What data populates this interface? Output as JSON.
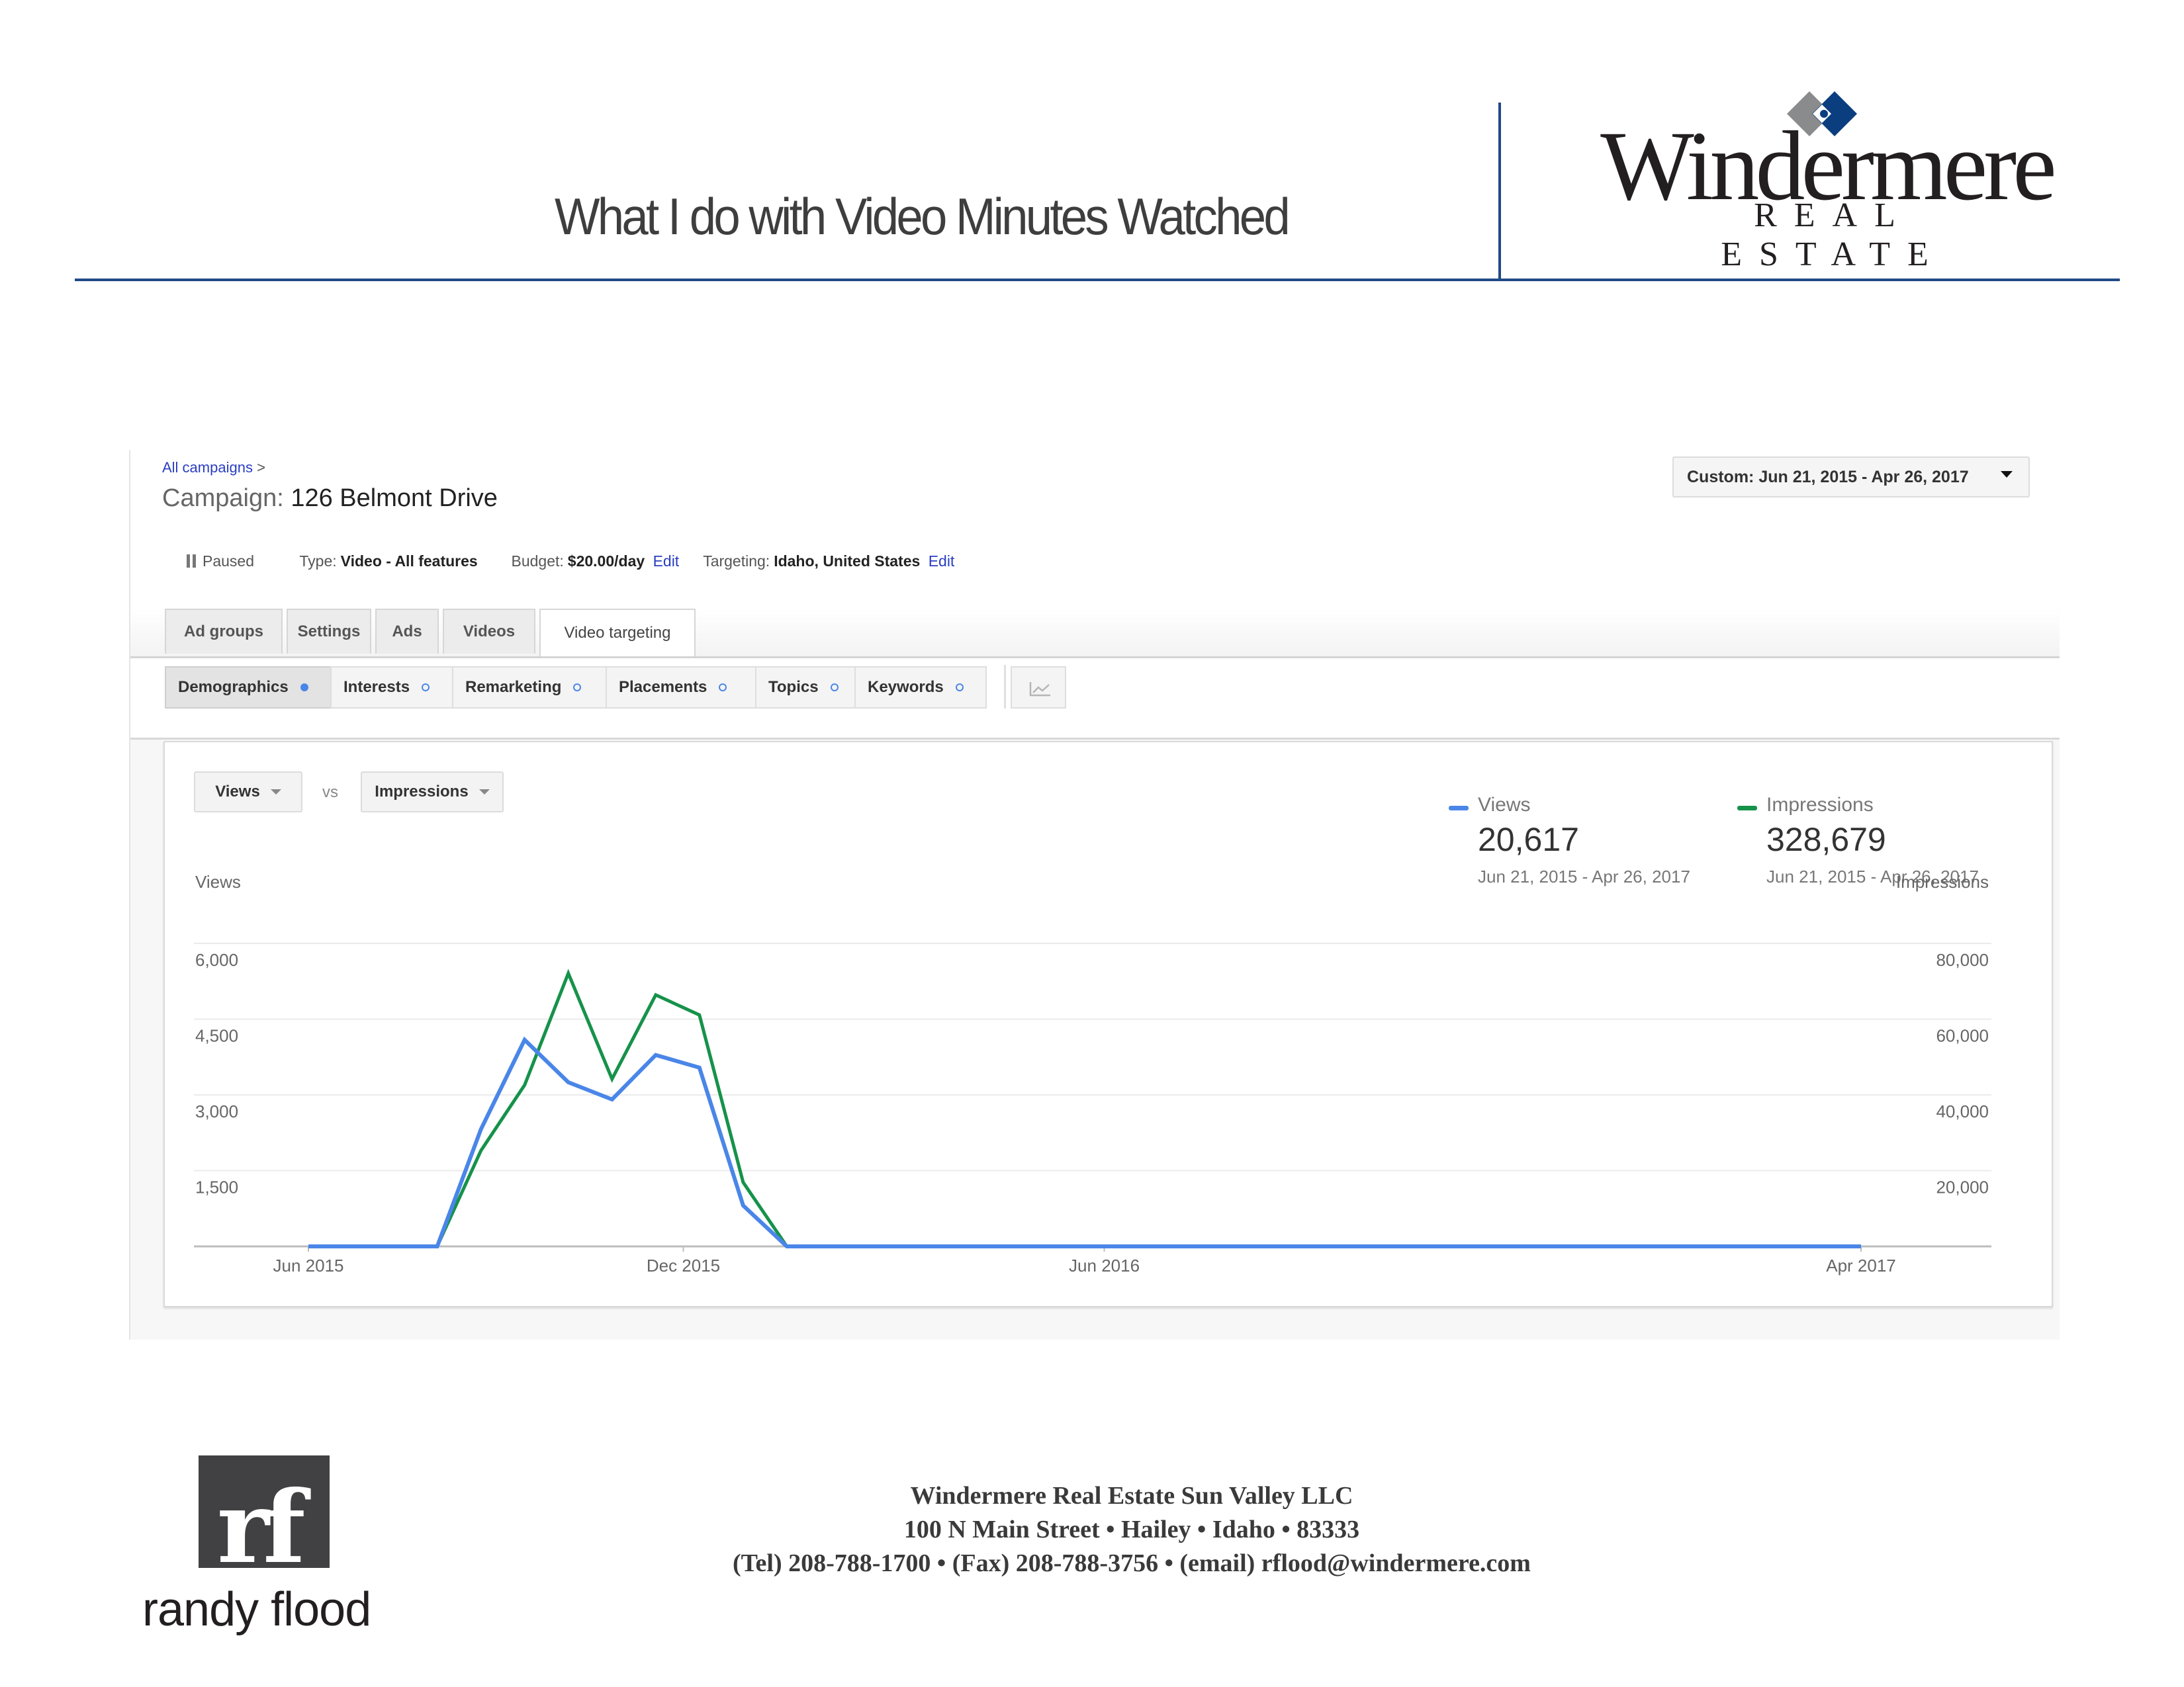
{
  "page": {
    "title": "What I do with Video Minutes Watched"
  },
  "brand": {
    "name": "Windermere",
    "subtitle": "REAL ESTATE",
    "colors": {
      "navy": "#1f4a86",
      "mark_gray": "#8a8b8d",
      "mark_blue": "#0b3e7f"
    }
  },
  "adwords": {
    "breadcrumb": {
      "link": "All campaigns",
      "separator": ">"
    },
    "campaign": {
      "label": "Campaign:",
      "name": "126 Belmont Drive"
    },
    "date_range_button": "Custom: Jun 21, 2015 - Apr 26, 2017",
    "meta": {
      "status": "Paused",
      "type_label": "Type:",
      "type_value": "Video - All features",
      "budget_label": "Budget:",
      "budget_value": "$20.00/day",
      "budget_edit": "Edit",
      "targeting_label": "Targeting:",
      "targeting_value": "Idaho, United States",
      "targeting_edit": "Edit"
    },
    "tabs": [
      {
        "label": "Ad groups",
        "active": false
      },
      {
        "label": "Settings",
        "active": false
      },
      {
        "label": "Ads",
        "active": false
      },
      {
        "label": "Videos",
        "active": false
      },
      {
        "label": "Video targeting",
        "active": true
      }
    ],
    "subtabs": [
      {
        "label": "Demographics",
        "active": true,
        "enabled": true
      },
      {
        "label": "Interests",
        "active": false,
        "enabled": false
      },
      {
        "label": "Remarketing",
        "active": false,
        "enabled": false
      },
      {
        "label": "Placements",
        "active": false,
        "enabled": false
      },
      {
        "label": "Topics",
        "active": false,
        "enabled": false
      },
      {
        "label": "Keywords",
        "active": false,
        "enabled": false
      }
    ],
    "chart_toggle_icon": "line-chart-icon",
    "metric_selectors": {
      "primary": "Views",
      "vs": "vs",
      "secondary": "Impressions"
    },
    "summary": [
      {
        "name": "Views",
        "value": "20,617",
        "range": "Jun 21, 2015 - Apr 26, 2017",
        "color": "#4a86e8"
      },
      {
        "name": "Impressions",
        "value": "328,679",
        "range": "Jun 21, 2015 - Apr 26, 2017",
        "color": "#16924a"
      }
    ]
  },
  "chart_data": {
    "type": "line",
    "title": "",
    "x_tick_labels": [
      "Jun 2015",
      "Dec 2015",
      "Jun 2016",
      "Apr 2017"
    ],
    "x": [
      "2015-06-21",
      "2015-07-28",
      "2015-08-16",
      "2015-09-04",
      "2015-09-23",
      "2015-10-12",
      "2015-10-31",
      "2015-11-19",
      "2015-12-08",
      "2015-12-27",
      "2016-01-15",
      "2016-02-03",
      "2016-02-22",
      "2016-06-01",
      "2016-12-01",
      "2017-04-26"
    ],
    "y_left_label": "Views",
    "y_right_label": "Impressions",
    "y_left_ticks": [
      "1,500",
      "3,000",
      "4,500",
      "6,000"
    ],
    "y_right_ticks": [
      "20,000",
      "40,000",
      "60,000",
      "80,000"
    ],
    "y_left_range": [
      0,
      6000
    ],
    "y_right_range": [
      0,
      80000
    ],
    "grid": true,
    "legend": "top-right",
    "series": [
      {
        "name": "Views",
        "axis": "left",
        "color": "#4a86e8",
        "values": [
          0,
          0,
          0,
          2320,
          4090,
          3250,
          2910,
          3790,
          3540,
          810,
          0,
          0,
          0,
          0,
          0,
          0
        ]
      },
      {
        "name": "Impressions",
        "axis": "right",
        "color": "#16924a",
        "values": [
          0,
          0,
          0,
          25300,
          42600,
          72100,
          44200,
          66400,
          61100,
          16900,
          0,
          0,
          0,
          0,
          0,
          0
        ]
      }
    ]
  },
  "footer": {
    "agent_initials": "rf",
    "agent_name": "randy flood",
    "company": "Windermere Real Estate Sun Valley LLC",
    "address": "100 N Main Street • Hailey • Idaho • 83333",
    "contact": "(Tel) 208-788-1700 • (Fax) 208-788-3756 • (email) rflood@windermere.com"
  }
}
